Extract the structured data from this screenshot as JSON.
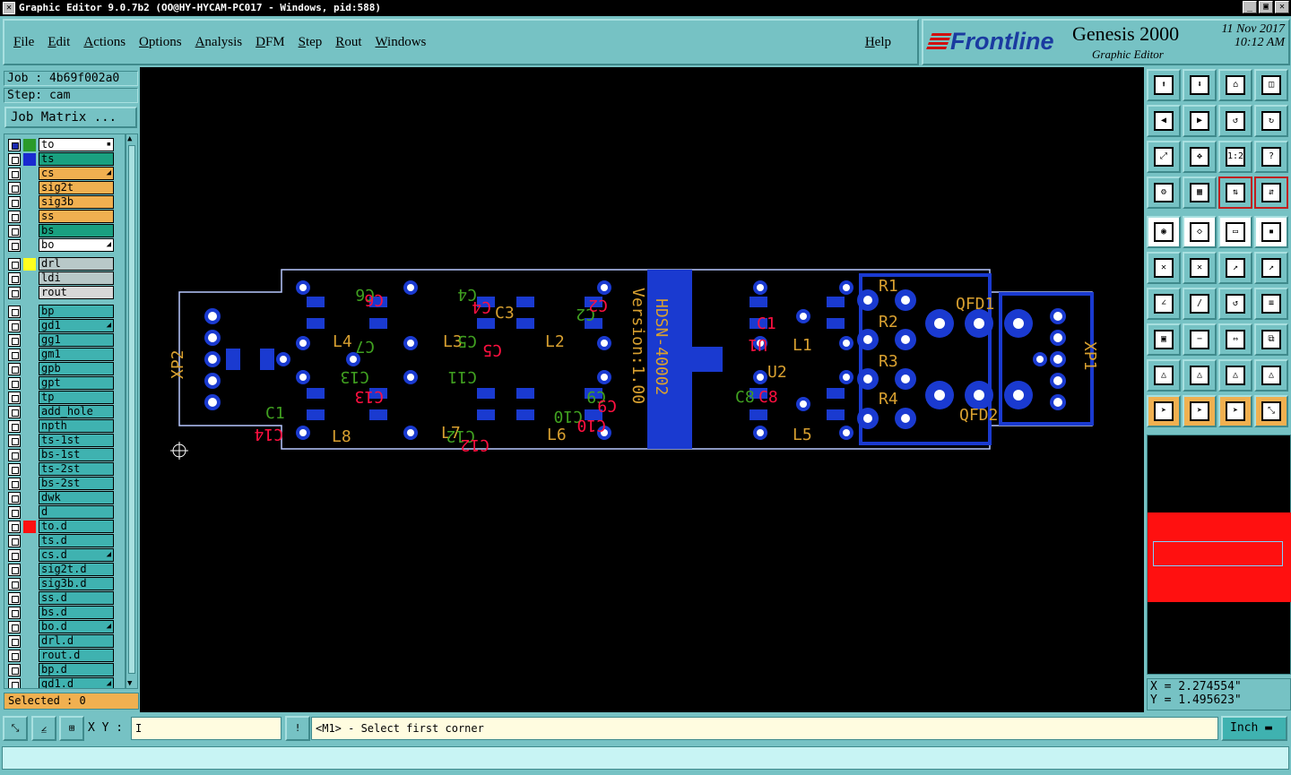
{
  "window": {
    "title": "Graphic Editor 9.0.7b2 (OO@HY-HYCAM-PC017 - Windows, pid:588)"
  },
  "menu": [
    "File",
    "Edit",
    "Actions",
    "Options",
    "Analysis",
    "DFM",
    "Step",
    "Rout",
    "Windows"
  ],
  "help_label": "Help",
  "brand": {
    "logo": "Frontline",
    "product": "Genesis 2000",
    "subtitle": "Graphic Editor",
    "date": "11 Nov 2017",
    "time": "10:12 AM"
  },
  "job": {
    "label": "Job : 4b69f002a0",
    "step": "Step: cam",
    "matrix_button": "Job Matrix ..."
  },
  "layers": [
    {
      "name": "to",
      "color": "#2a9a2a",
      "bg": "#ffffff",
      "mark": "▪",
      "active": true
    },
    {
      "name": "ts",
      "color": "#1a2ad0",
      "bg": "#1aa080"
    },
    {
      "name": "cs",
      "color": "",
      "bg": "#f0b050",
      "mark": "◢"
    },
    {
      "name": "sig2t",
      "color": "",
      "bg": "#f0b050"
    },
    {
      "name": "sig3b",
      "color": "",
      "bg": "#f0b050"
    },
    {
      "name": "ss",
      "color": "",
      "bg": "#f0b050"
    },
    {
      "name": "bs",
      "color": "",
      "bg": "#1aa080"
    },
    {
      "name": "bo",
      "color": "",
      "bg": "#ffffff",
      "mark": "◢"
    },
    {
      "name": "drl",
      "color": "#ffff20",
      "bg": "#b8c8c8",
      "gap": true
    },
    {
      "name": "ldi",
      "color": "",
      "bg": "#b8c8c8"
    },
    {
      "name": "rout",
      "color": "",
      "bg": "#d8d8d8"
    },
    {
      "name": "bp",
      "color": "",
      "bg": "#3fb2b0",
      "gap": true
    },
    {
      "name": "gd1",
      "color": "",
      "bg": "#3fb2b0",
      "mark": "◢"
    },
    {
      "name": "gg1",
      "color": "",
      "bg": "#3fb2b0"
    },
    {
      "name": "gm1",
      "color": "",
      "bg": "#3fb2b0"
    },
    {
      "name": "gpb",
      "color": "",
      "bg": "#3fb2b0"
    },
    {
      "name": "gpt",
      "color": "",
      "bg": "#3fb2b0"
    },
    {
      "name": "tp",
      "color": "",
      "bg": "#3fb2b0"
    },
    {
      "name": "add_hole",
      "color": "",
      "bg": "#3fb2b0"
    },
    {
      "name": "npth",
      "color": "",
      "bg": "#3fb2b0"
    },
    {
      "name": "ts-1st",
      "color": "",
      "bg": "#3fb2b0"
    },
    {
      "name": "bs-1st",
      "color": "",
      "bg": "#3fb2b0"
    },
    {
      "name": "ts-2st",
      "color": "",
      "bg": "#3fb2b0"
    },
    {
      "name": "bs-2st",
      "color": "",
      "bg": "#3fb2b0"
    },
    {
      "name": "dwk",
      "color": "",
      "bg": "#3fb2b0"
    },
    {
      "name": "d",
      "color": "",
      "bg": "#3fb2b0"
    },
    {
      "name": "to.d",
      "color": "#ff1010",
      "bg": "#3fb2b0"
    },
    {
      "name": "ts.d",
      "color": "",
      "bg": "#3fb2b0"
    },
    {
      "name": "cs.d",
      "color": "",
      "bg": "#3fb2b0",
      "mark": "◢"
    },
    {
      "name": "sig2t.d",
      "color": "",
      "bg": "#3fb2b0"
    },
    {
      "name": "sig3b.d",
      "color": "",
      "bg": "#3fb2b0"
    },
    {
      "name": "ss.d",
      "color": "",
      "bg": "#3fb2b0"
    },
    {
      "name": "bs.d",
      "color": "",
      "bg": "#3fb2b0"
    },
    {
      "name": "bo.d",
      "color": "",
      "bg": "#3fb2b0",
      "mark": "◢"
    },
    {
      "name": "drl.d",
      "color": "",
      "bg": "#3fb2b0"
    },
    {
      "name": "rout.d",
      "color": "",
      "bg": "#3fb2b0"
    },
    {
      "name": "bp.d",
      "color": "",
      "bg": "#3fb2b0"
    },
    {
      "name": "gd1.d",
      "color": "",
      "bg": "#3fb2b0",
      "mark": "◢"
    }
  ],
  "selected": "Selected : 0",
  "pcb": {
    "labels_orange": [
      "XP2",
      "L4",
      "L3",
      "L2",
      "L8",
      "L7",
      "L6",
      "C3",
      "L1",
      "U2",
      "R1",
      "R2",
      "R3",
      "R4",
      "QFD1",
      "QFD2",
      "L5",
      "XP1",
      "HDSN-40002",
      "Version:1.00"
    ],
    "labels_green": [
      "C1",
      "C7",
      "C11",
      "C13",
      "C10",
      "C6",
      "C4",
      "C5",
      "C2",
      "C8",
      "C12",
      "C9"
    ],
    "labels_red": [
      "C14",
      "C13",
      "C10",
      "C6",
      "C4",
      "C5",
      "C2",
      "C8",
      "C12",
      "C1",
      "C9",
      "U1"
    ]
  },
  "tools": {
    "row_icons": [
      "⬆",
      "⬇",
      "⌂",
      "◫",
      "◀",
      "▶",
      "↺",
      "↻",
      "⤢",
      "✥",
      "1:2",
      "?",
      "⚙",
      "▦",
      "⇅",
      "⇵",
      "◉",
      "◇",
      "▭",
      "▪",
      "✕",
      "✕",
      "↗",
      "↗",
      "∠",
      "/",
      "↺",
      "≡",
      "▣",
      "−",
      "⇔",
      "⧉",
      "△",
      "△",
      "△",
      "△",
      "➤",
      "➤",
      "➤",
      "⤡"
    ]
  },
  "coords": {
    "x": "X = 2.274554\"",
    "y": "Y = 1.495623\""
  },
  "cmdbar": {
    "xy_label": "X Y :",
    "xy_value": "I",
    "prompt": "<M1> - Select first corner",
    "unit": "Inch"
  }
}
